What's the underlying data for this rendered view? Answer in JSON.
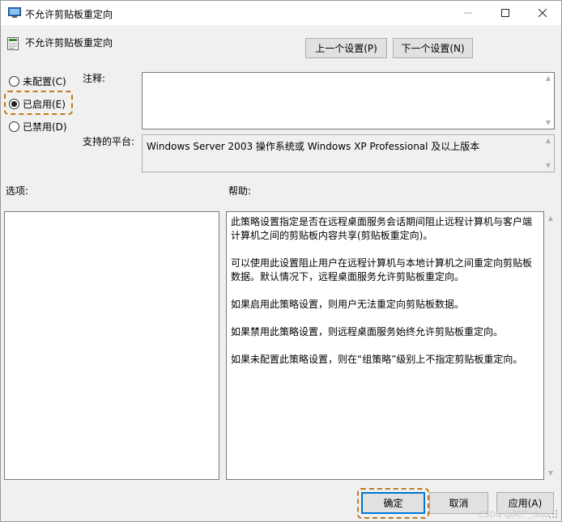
{
  "window": {
    "title": "不允许剪贴板重定向"
  },
  "header": {
    "policy_name": "不允许剪贴板重定向",
    "prev_button": "上一个设置(P)",
    "next_button": "下一个设置(N)"
  },
  "state": {
    "options": [
      {
        "label": "未配置(C)",
        "checked": false
      },
      {
        "label": "已启用(E)",
        "checked": true
      },
      {
        "label": "已禁用(D)",
        "checked": false
      }
    ]
  },
  "comment": {
    "label": "注释:",
    "value": ""
  },
  "platform": {
    "label": "支持的平台:",
    "value": "Windows Server 2003 操作系统或 Windows XP Professional 及以上版本"
  },
  "sections": {
    "options_label": "选项:",
    "help_label": "帮助:"
  },
  "help": {
    "paragraphs": [
      "此策略设置指定是否在远程桌面服务会话期间阻止远程计算机与客户端计算机之间的剪贴板内容共享(剪贴板重定向)。",
      "可以使用此设置阻止用户在远程计算机与本地计算机之间重定向剪贴板数据。默认情况下，远程桌面服务允许剪贴板重定向。",
      "如果启用此策略设置，则用户无法重定向剪贴板数据。",
      "如果禁用此策略设置，则远程桌面服务始终允许剪贴板重定向。",
      "如果未配置此策略设置，则在“组策略”级别上不指定剪贴板重定向。"
    ]
  },
  "footer": {
    "ok": "确定",
    "cancel": "取消",
    "apply": "应用(A)"
  },
  "watermark": "CSDN @阿广_Guo",
  "colors": {
    "highlight_dash": "#c07a1a",
    "default_button_border": "#0078d7"
  }
}
